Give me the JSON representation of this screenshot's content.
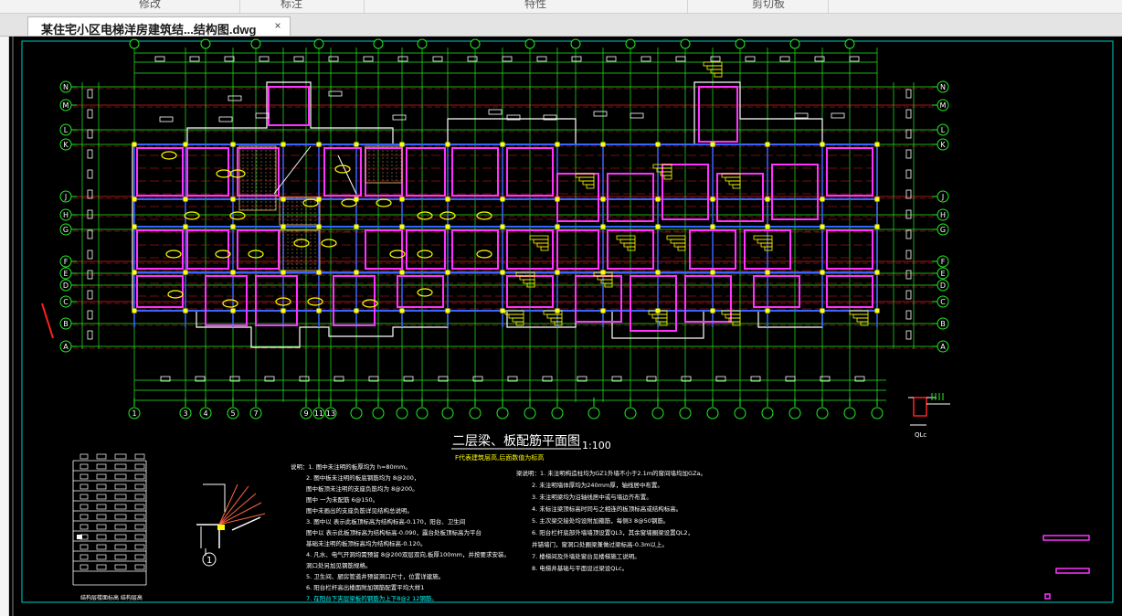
{
  "ribbon": {
    "groups": [
      "修改",
      "标注",
      "特性",
      "剪切板"
    ]
  },
  "document_tab": {
    "title": "某住宅小区电梯洋房建筑结...结构图.dwg",
    "close_glyph": "×"
  },
  "drawing": {
    "title": "二层梁、板配筋平面图",
    "scale": "1:100",
    "subtitle": "F代表建筑层高,后面数值为标高",
    "axes_left": [
      "N",
      "M",
      "L",
      "K",
      "J",
      "H",
      "G",
      "F",
      "E",
      "D",
      "C",
      "B",
      "A"
    ],
    "axes_bottom": [
      "1",
      "3",
      "4",
      "5",
      "7",
      "9",
      "11",
      "13"
    ],
    "detail_marker": "1",
    "section_label": "结构层楼面标高 结构层高",
    "small_label": "QLc",
    "notes_left": [
      "说明：1. 图中未注明的板厚均为 h=80mm。",
      "2. 图中板未注明的板底钢筋均为 8@200，",
      "图中板顶未注明的支座负筋均为 8@200。",
      "图中     一为未配筋   6@150。",
      "图中未画出的支座负筋详见结构总说明。",
      "3. 图中以     表示此板顶标高为结构标高-0.170，阳台、卫生间",
      "图中以     表示此板顶标高为结构标高-0.090，露台处板顶标高为平台",
      "基础未注明的板顶标高均为结构标高-0.120。",
      "4. 凡水、电气开洞均需预留 8@200双层双向,板厚100mm，并按要求安装。",
      "洞口处另加见钢筋规格。",
      "5. 卫生间、厨房管道井预留洞口尺寸，位置详建施。",
      "6. 阳台栏杆高出楼面附加钢筋配置平均大样1",
      "7. 在阳台下夹层梁板的钢筋为上下8@2  12钢筋。"
    ],
    "notes_right": [
      "梁说明：1. 未注明构造柱均为GZ1外墙不小于2.1m的窗间墙均加GZa。",
      "2. 未注明墙体厚均为240mm厚，轴线居中布置。",
      "3. 未注明梁均为沿轴线居中或与墙边齐布置。",
      "4. 未标注梁顶标高时同与之相连的板顶标高或结构标高。",
      "5. 主次梁交接处均设附加箍筋，每侧3 8@50钢筋。",
      "6. 阳台栏杆底部外墙墙顶设置QL3，其余窗墙圈梁设置QL2，",
      "并锚墙门，窗洞口处圈梁兼做过梁标高-0.3m以上。",
      "7. 楼梯间及外墙处窗台见楼梯施工说明。",
      "8. 电梯井基础与平面设过梁设QLc。"
    ]
  },
  "colors": {
    "viewport_bg": "#000000",
    "grid_line": "#22ee22",
    "axis_red": "#dd2222",
    "wall_magenta": "#ff33ff",
    "slab_white": "#ffffff",
    "beam_blue": "#3a64ff",
    "note_yellow": "#ffff00",
    "frame_cyan": "#00cccc",
    "hatch_orange": "#c8a060"
  }
}
